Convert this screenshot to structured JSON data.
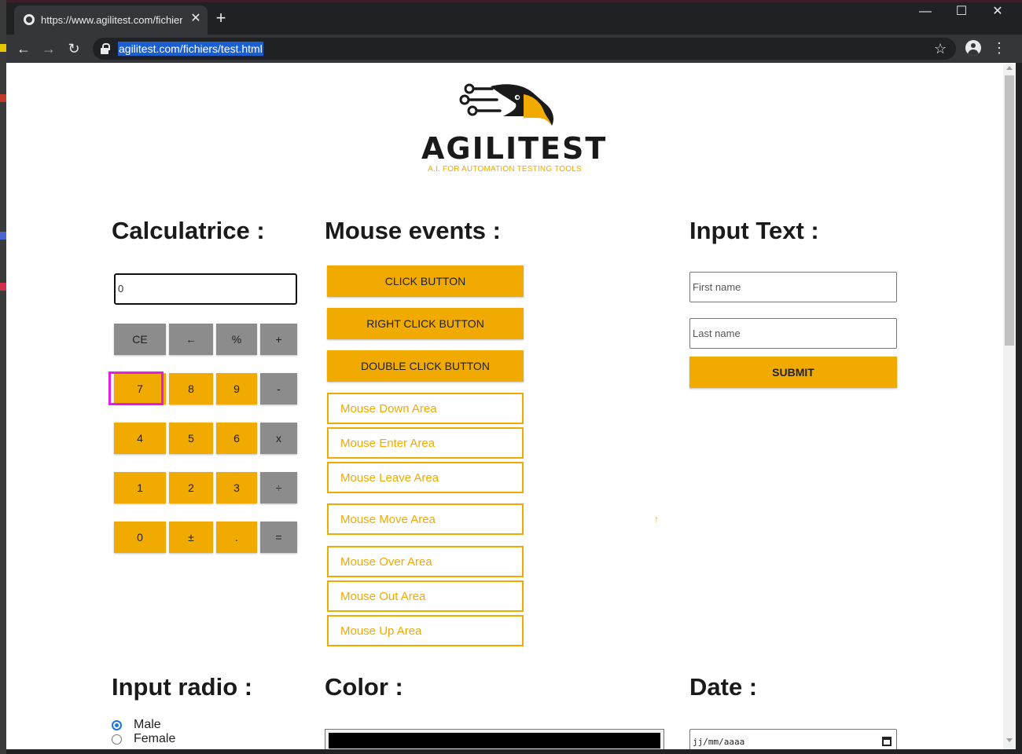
{
  "browser": {
    "tab_title": "https://www.agilitest.com/fichiers/test.html",
    "tab_close": "✕",
    "new_tab": "+",
    "window_minimize": "—",
    "window_maximize": "☐",
    "window_close": "✕",
    "url": "agilitest.com/fichiers/test.html",
    "nav_back": "←",
    "nav_forward": "→",
    "nav_reload": "↻",
    "star": "☆",
    "menu": "⋮"
  },
  "logo": {
    "wordmark": "AGILITEST",
    "tagline": "A.I. FOR AUTOMATION TESTING TOOLS"
  },
  "calculator": {
    "heading": "Calculatrice :",
    "display_value": "0",
    "focused_key": "7",
    "keys": [
      {
        "label": "CE",
        "type": "op"
      },
      {
        "label": "←",
        "type": "op"
      },
      {
        "label": "%",
        "type": "op"
      },
      {
        "label": "+",
        "type": "op"
      },
      {
        "label": "7",
        "type": "num"
      },
      {
        "label": "8",
        "type": "num"
      },
      {
        "label": "9",
        "type": "num"
      },
      {
        "label": "-",
        "type": "op"
      },
      {
        "label": "4",
        "type": "num"
      },
      {
        "label": "5",
        "type": "num"
      },
      {
        "label": "6",
        "type": "num"
      },
      {
        "label": "x",
        "type": "op"
      },
      {
        "label": "1",
        "type": "num"
      },
      {
        "label": "2",
        "type": "num"
      },
      {
        "label": "3",
        "type": "num"
      },
      {
        "label": "÷",
        "type": "op"
      },
      {
        "label": "0",
        "type": "num"
      },
      {
        "label": "±",
        "type": "num"
      },
      {
        "label": ".",
        "type": "num"
      },
      {
        "label": "=",
        "type": "op"
      }
    ]
  },
  "mouse_events": {
    "heading": "Mouse events :",
    "buttons": [
      "CLICK BUTTON",
      "RIGHT CLICK BUTTON",
      "DOUBLE CLICK BUTTON"
    ],
    "areas": [
      "Mouse Down Area",
      "Mouse Enter Area",
      "Mouse Leave Area",
      "Mouse Move Area",
      "Mouse Over Area",
      "Mouse Out Area",
      "Mouse Up Area"
    ],
    "move_marker": "↑"
  },
  "input_text": {
    "heading": "Input Text :",
    "first_name_placeholder": "First name",
    "last_name_placeholder": "Last name",
    "submit_label": "SUBMIT"
  },
  "input_radio": {
    "heading": "Input radio :",
    "options": [
      {
        "label": "Male",
        "checked": true
      },
      {
        "label": "Female",
        "checked": false
      }
    ]
  },
  "color": {
    "heading": "Color :",
    "value": "#000000"
  },
  "date": {
    "heading": "Date :",
    "placeholder": "jj/mm/aaaa"
  },
  "colors": {
    "accent": "#f0aa00",
    "operator_key": "#8c8c8c",
    "focus_ring": "#e61ce6",
    "url_selection": "#1a5fd0"
  }
}
